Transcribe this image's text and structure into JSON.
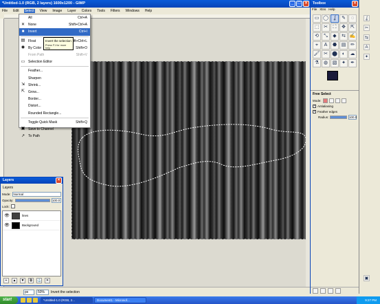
{
  "main_window": {
    "title": "*Untitled-1.0 (RGB, 2 layers) 1600x1200 - GIMP",
    "menus": [
      "File",
      "Edit",
      "Select",
      "View",
      "Image",
      "Layer",
      "Colors",
      "Tools",
      "Filters",
      "Windows",
      "Help"
    ],
    "active_menu": "Select"
  },
  "select_menu": {
    "items": [
      {
        "label": "All",
        "shortcut": "Ctrl+A",
        "icon": "select-all-icon",
        "glyph": "",
        "state": "normal"
      },
      {
        "label": "None",
        "shortcut": "Shift+Ctrl+A",
        "icon": "select-none-icon",
        "glyph": "✕",
        "state": "normal"
      },
      {
        "label": "Invert",
        "shortcut": "Ctrl+I",
        "icon": "invert-icon",
        "glyph": "■",
        "state": "highlighted"
      },
      {
        "label": "Float",
        "shortcut": "Shift+Ctrl+L",
        "icon": "float-icon",
        "glyph": "▤",
        "state": "normal"
      },
      {
        "label": "By Color",
        "shortcut": "Shift+O",
        "icon": "by-color-icon",
        "glyph": "◉",
        "state": "normal"
      },
      {
        "label": "From Path",
        "shortcut": "Shift+V",
        "icon": "from-path-icon",
        "glyph": "",
        "state": "disabled"
      },
      {
        "label": "Selection Editor",
        "shortcut": "",
        "icon": "selection-editor-icon",
        "glyph": "▭",
        "state": "normal"
      },
      {
        "label": "Feather...",
        "shortcut": "",
        "icon": "",
        "glyph": "",
        "state": "normal"
      },
      {
        "label": "Sharpen",
        "shortcut": "",
        "icon": "",
        "glyph": "",
        "state": "normal"
      },
      {
        "label": "Shrink...",
        "shortcut": "",
        "icon": "shrink-icon",
        "glyph": "⇲",
        "state": "normal"
      },
      {
        "label": "Grow...",
        "shortcut": "",
        "icon": "grow-icon",
        "glyph": "⇱",
        "state": "normal"
      },
      {
        "label": "Border...",
        "shortcut": "",
        "icon": "",
        "glyph": "",
        "state": "normal"
      },
      {
        "label": "Distort...",
        "shortcut": "",
        "icon": "",
        "glyph": "",
        "state": "normal"
      },
      {
        "label": "Rounded Rectangle...",
        "shortcut": "",
        "icon": "",
        "glyph": "",
        "state": "normal"
      },
      {
        "label": "Toggle Quick Mask",
        "shortcut": "Shift+Q",
        "icon": "",
        "glyph": "",
        "state": "normal"
      },
      {
        "label": "Save to Channel",
        "shortcut": "",
        "icon": "save-channel-icon",
        "glyph": "▣",
        "state": "normal"
      },
      {
        "label": "To Path",
        "shortcut": "",
        "icon": "to-path-icon",
        "glyph": "↗",
        "state": "normal"
      }
    ],
    "separators_after": [
      2,
      6,
      13
    ]
  },
  "tooltip": {
    "text": "Invert the selection",
    "hint": "Press F1 for more help"
  },
  "status": {
    "unit": "px",
    "zoom": "50%",
    "message": "Invert the selection"
  },
  "layers_window": {
    "title": "Layers",
    "tab": "Layers",
    "mode_label": "Mode:",
    "mode_value": "Normal",
    "opacity_label": "Opacity:",
    "opacity_value": "100.0",
    "opacity_fraction": 1.0,
    "lock_label": "Lock:",
    "layers": [
      {
        "name": "lines",
        "thumb": "lines"
      },
      {
        "name": "Background",
        "thumb": "bg"
      }
    ]
  },
  "toolbox": {
    "title": "Toolbox",
    "menus": [
      "File",
      "Xtns",
      "Help"
    ],
    "tools": [
      "▭",
      "◯",
      "ʆ",
      "✎",
      "◌",
      "⬚",
      "✂",
      "⛶",
      "✥",
      "⇱",
      "⟲",
      "⤡",
      "◆",
      "⇆",
      "✍",
      "⌖",
      "A",
      "⬣",
      "▤",
      "✏",
      "🖌",
      "✂",
      "⬤",
      "◐",
      "☁",
      "⚗",
      "◍",
      "▧",
      "✦",
      "✒"
    ],
    "selected_tool_index": 2,
    "tool_options_title": "Free Select",
    "mode_label": "Mode:",
    "antialiasing_label": "Antialiasing",
    "feather_label": "Feather edges",
    "radius_label": "Radius:",
    "radius_value": "100.0",
    "radius_fraction": 1.0
  },
  "taskbar": {
    "start": "start",
    "tasks": [
      "*Untitled-1.0 (RGB, 2...",
      "Document1 - Microsof..."
    ],
    "time": "9:27 PM"
  },
  "colors": {
    "titlebar": "#0844b8",
    "highlight": "#316ac5",
    "foreground": "#1a1a3a",
    "background": "#1a0fa0"
  }
}
